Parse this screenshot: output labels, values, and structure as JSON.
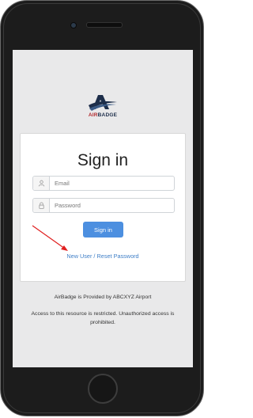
{
  "logo": {
    "word_air": "AIR",
    "word_badge": "BADGE",
    "colors": {
      "air": "#b22a2e",
      "badge": "#1d2e4a"
    }
  },
  "login": {
    "title": "Sign in",
    "email_placeholder": "Email",
    "email_value": "",
    "password_placeholder": "Password",
    "password_value": "",
    "signin_label": "Sign in",
    "reset_link": "New User / Reset Password",
    "icons": {
      "email": "user-icon",
      "password": "lock-icon"
    }
  },
  "footer": {
    "provided": "AirBadge is Provided by ABCXYZ Airport",
    "restricted": "Access to this resource is restricted. Unauthorized access is prohibited."
  },
  "annotation": {
    "type": "red-arrow",
    "color": "#e02020"
  },
  "colors": {
    "primary": "#4c8fe0",
    "link": "#3f7fc7",
    "screen_bg": "#e9e9ea"
  }
}
